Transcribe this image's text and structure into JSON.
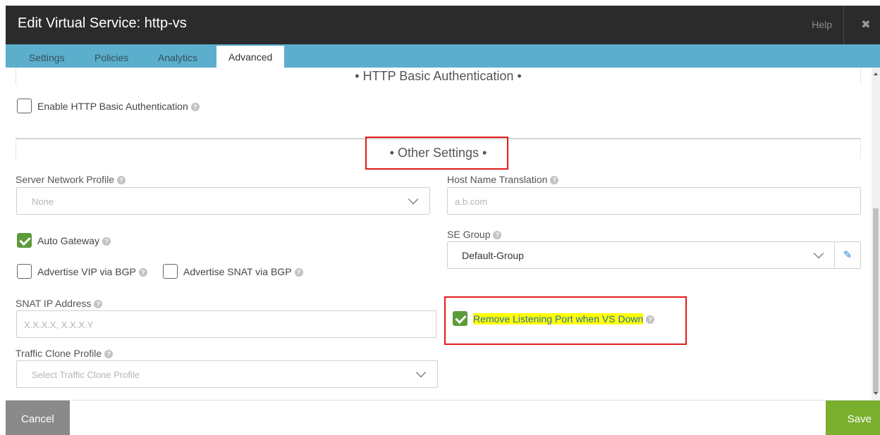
{
  "header": {
    "title": "Edit Virtual Service: http-vs",
    "help_label": "Help",
    "close_icon": "close-icon"
  },
  "tabs": [
    {
      "label": "Settings"
    },
    {
      "label": "Policies"
    },
    {
      "label": "Analytics"
    },
    {
      "label": "Advanced",
      "active": true
    }
  ],
  "http_auth": {
    "section_title": "• HTTP Basic Authentication •",
    "enable_label": "Enable HTTP Basic Authentication",
    "enabled": false
  },
  "other_settings": {
    "section_title": "• Other Settings •",
    "server_network_profile": {
      "label": "Server Network Profile",
      "placeholder": "None"
    },
    "host_name_translation": {
      "label": "Host Name Translation",
      "placeholder": "a.b.com"
    },
    "auto_gateway": {
      "label": "Auto Gateway",
      "checked": true
    },
    "se_group": {
      "label": "SE Group",
      "value": "Default-Group"
    },
    "advertise_vip": {
      "label": "Advertise VIP via BGP",
      "checked": false
    },
    "advertise_snat": {
      "label": "Advertise SNAT via BGP",
      "checked": false
    },
    "snat_ip": {
      "label": "SNAT IP Address",
      "placeholder": "X.X.X.X, X.X.X.Y"
    },
    "remove_listening_port": {
      "label": "Remove Listening Port when VS Down",
      "checked": true
    },
    "traffic_clone_profile": {
      "label": "Traffic Clone Profile",
      "placeholder": "Select Traffic Clone Profile"
    }
  },
  "footer": {
    "cancel_label": "Cancel",
    "save_label": "Save"
  },
  "colors": {
    "header_bg": "#2b2b2b",
    "tab_bar": "#5bafcc",
    "check_green": "#5c9b3a",
    "save_green": "#7ab02e",
    "annotation_red": "#e11b1b",
    "highlight_yellow": "#ffff00"
  }
}
